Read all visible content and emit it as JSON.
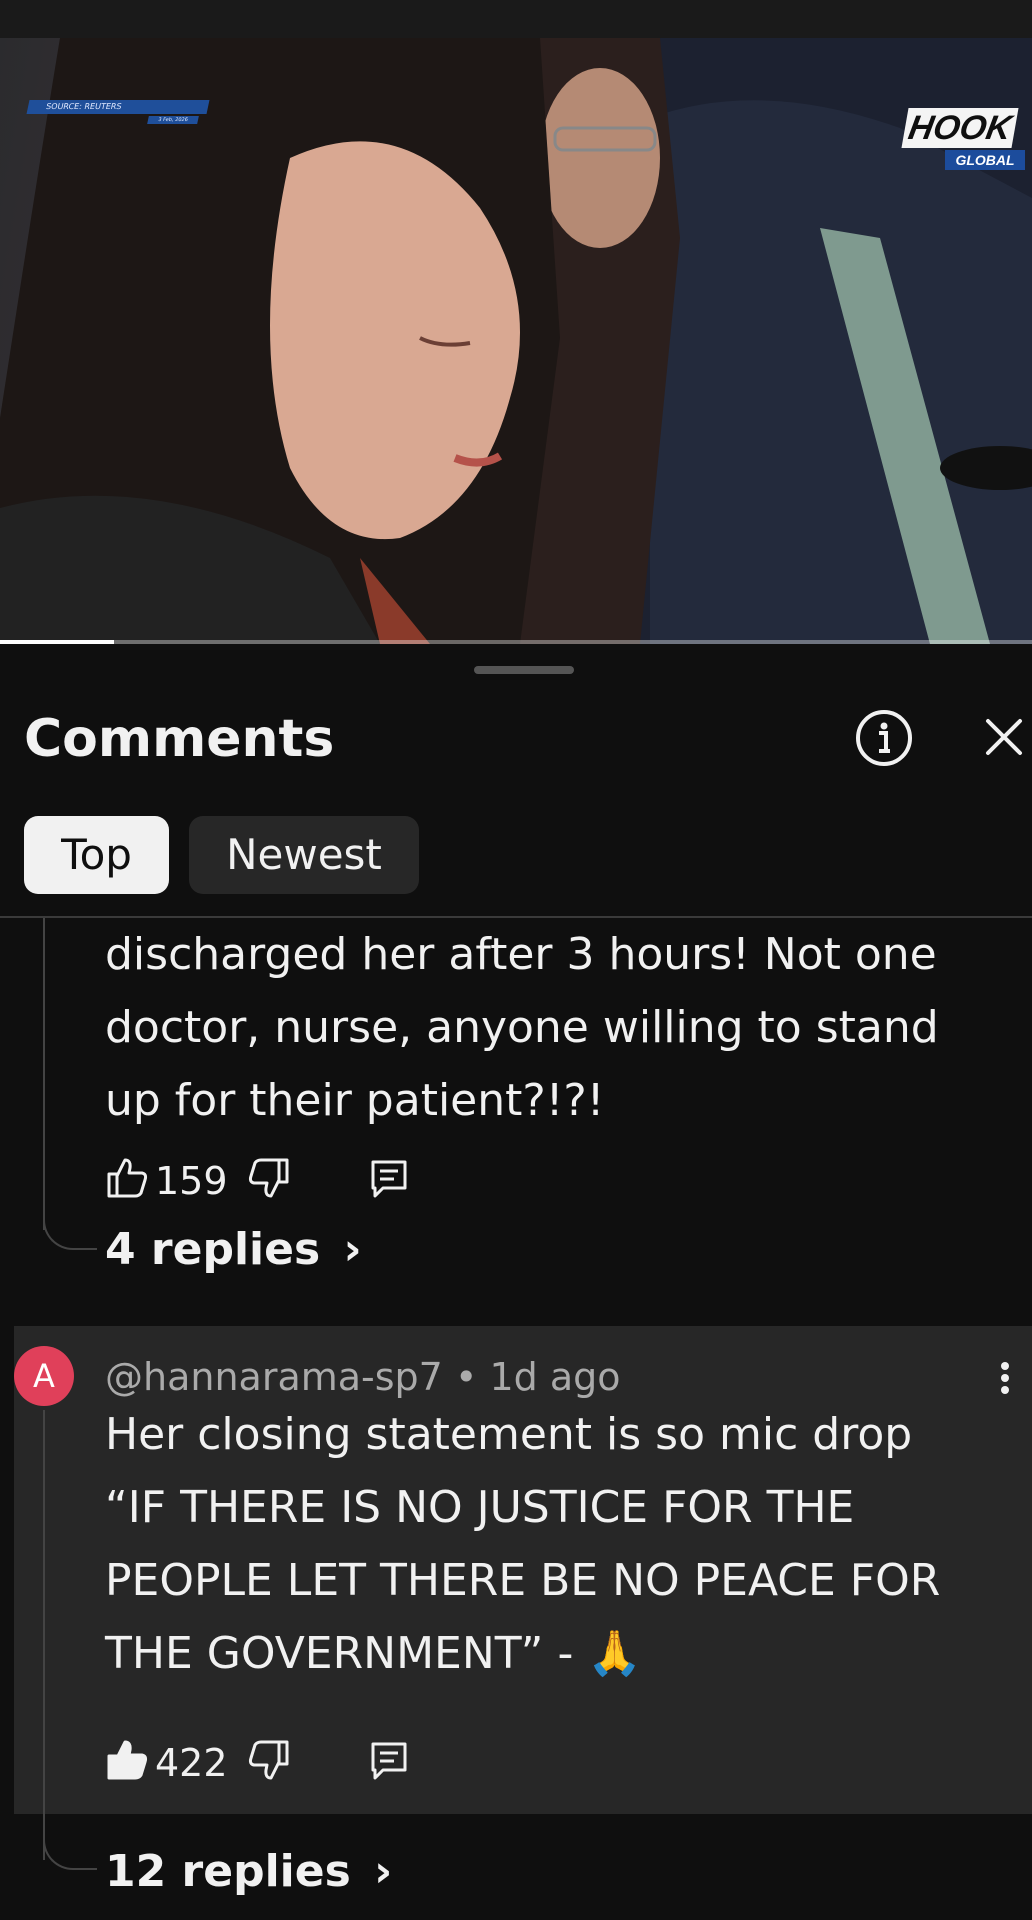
{
  "video": {
    "source_tag": "SOURCE: REUTERS",
    "source_date": "3 Feb, 2026",
    "logo_text": "HOOK",
    "logo_sub": "GLOBAL",
    "progress": 0.11
  },
  "sheet": {
    "title": "Comments",
    "icons": {
      "info": "info-icon",
      "close": "close-icon"
    },
    "tabs": [
      {
        "label": "Top",
        "active": true
      },
      {
        "label": "Newest",
        "active": false
      }
    ]
  },
  "comments": [
    {
      "body_lines": [
        "discharged her after 3 hours! Not one",
        "doctor, nurse, anyone willing to stand",
        "up for their patient?!?!"
      ],
      "likes": "159",
      "liked": false,
      "replies_label": "4 replies"
    },
    {
      "avatar_letter": "A",
      "avatar_color": "#e0405a",
      "author": "@hannarama-sp7",
      "separator": "•",
      "time": "1d ago",
      "body_lines": [
        "Her closing statement is so mic drop",
        "“IF THERE IS NO JUSTICE FOR THE",
        "PEOPLE LET THERE BE NO PEACE FOR",
        "THE GOVERNMENT” - 🙏"
      ],
      "likes": "422",
      "liked": true,
      "replies_label": "12 replies"
    }
  ]
}
